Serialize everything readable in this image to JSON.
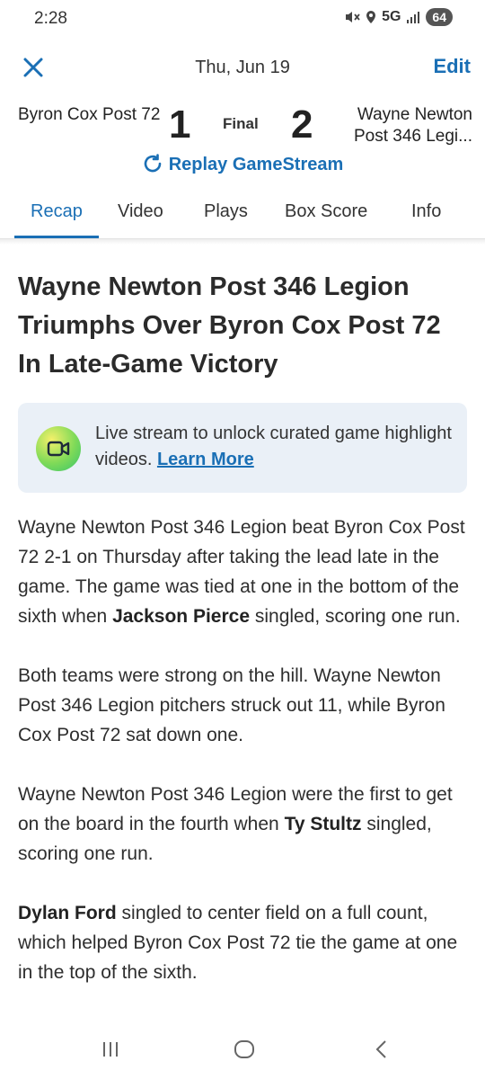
{
  "status_bar": {
    "time": "2:28",
    "network": "5G",
    "battery": "64"
  },
  "header": {
    "date": "Thu, Jun 19",
    "edit_label": "Edit"
  },
  "scoreboard": {
    "away_team": "Byron Cox Post 72",
    "away_score": "1",
    "status": "Final",
    "home_score": "2",
    "home_team": "Wayne Newton Post 346 Legi..."
  },
  "replay_label": "Replay GameStream",
  "tabs": [
    {
      "label": "Recap"
    },
    {
      "label": "Video"
    },
    {
      "label": "Plays"
    },
    {
      "label": "Box Score"
    },
    {
      "label": "Info"
    }
  ],
  "headline": "Wayne Newton Post 346 Legion Triumphs Over Byron Cox Post 72 In Late-Game Victory",
  "promo": {
    "text": "Live stream to unlock curated game highlight videos.",
    "link": "Learn More"
  },
  "article": {
    "p1_a": "Wayne Newton Post 346 Legion beat Byron Cox Post 72 2-1 on Thursday after taking the lead late in the game. The game was tied at one in the bottom of the sixth when",
    "p1_player": "Jackson Pierce",
    "p1_b": "singled, scoring one run.",
    "p2": "Both teams were strong on the hill. Wayne Newton Post 346 Legion pitchers struck out 11, while Byron Cox Post 72 sat down one.",
    "p3_a": "Wayne Newton Post 346 Legion were the first to get on the board in the fourth when",
    "p3_player": "Ty Stultz",
    "p3_b": "singled, scoring one run.",
    "p4_player": "Dylan Ford",
    "p4_b": "singled to center field on a full count, which helped Byron Cox Post 72 tie the game at one in the top of the sixth."
  },
  "colors": {
    "accent": "#1a6fb5",
    "promo_bg": "#eaf0f7",
    "text": "#222222"
  }
}
